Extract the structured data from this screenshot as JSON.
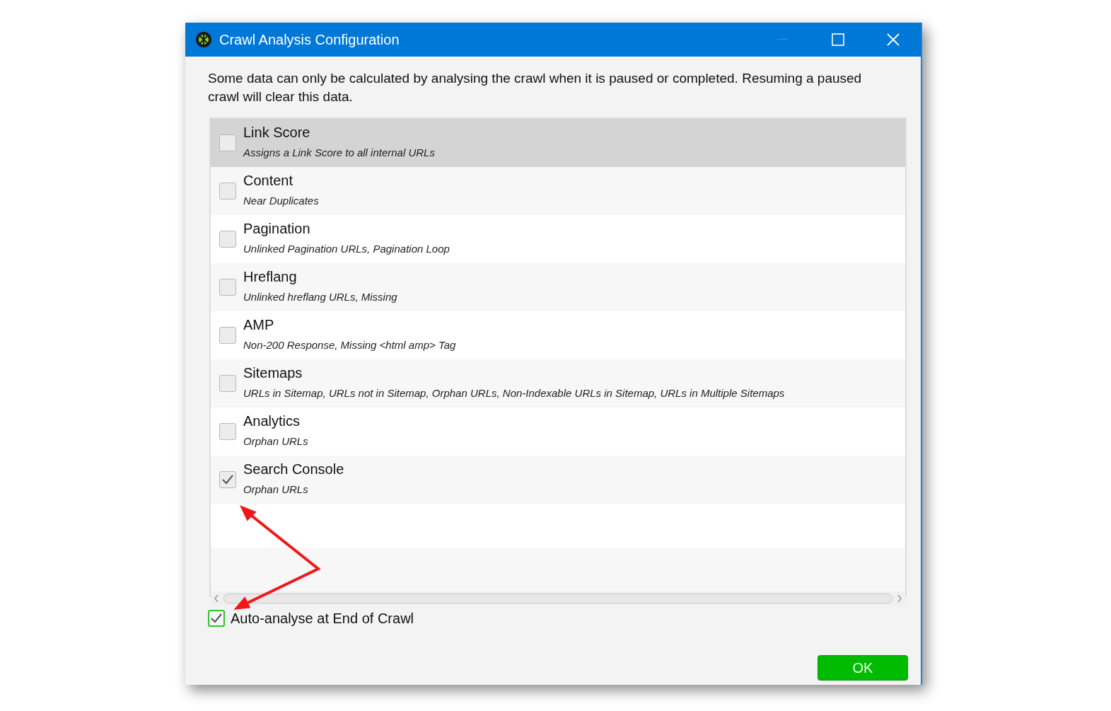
{
  "window": {
    "title": "Crawl Analysis Configuration"
  },
  "intro": "Some data can only be calculated by analysing the crawl when it is paused or completed. Resuming a paused crawl will clear this data.",
  "options": [
    {
      "name": "Link Score",
      "description": "Assigns a Link Score to all internal URLs",
      "checked": false,
      "selected": true
    },
    {
      "name": "Content",
      "description": "Near Duplicates",
      "checked": false,
      "selected": false
    },
    {
      "name": "Pagination",
      "description": "Unlinked Pagination URLs, Pagination Loop",
      "checked": false,
      "selected": false
    },
    {
      "name": "Hreflang",
      "description": "Unlinked hreflang URLs, Missing",
      "checked": false,
      "selected": false
    },
    {
      "name": "AMP",
      "description": "Non-200 Response, Missing <html amp> Tag",
      "checked": false,
      "selected": false
    },
    {
      "name": "Sitemaps",
      "description": "URLs in Sitemap, URLs not in Sitemap, Orphan URLs, Non-Indexable URLs in Sitemap, URLs in Multiple Sitemaps",
      "checked": false,
      "selected": false
    },
    {
      "name": "Analytics",
      "description": "Orphan URLs",
      "checked": false,
      "selected": false
    },
    {
      "name": "Search Console",
      "description": "Orphan URLs",
      "checked": true,
      "selected": false
    }
  ],
  "auto_analyse": {
    "label": "Auto-analyse at End of Crawl",
    "checked": true
  },
  "buttons": [
    "OK"
  ]
}
